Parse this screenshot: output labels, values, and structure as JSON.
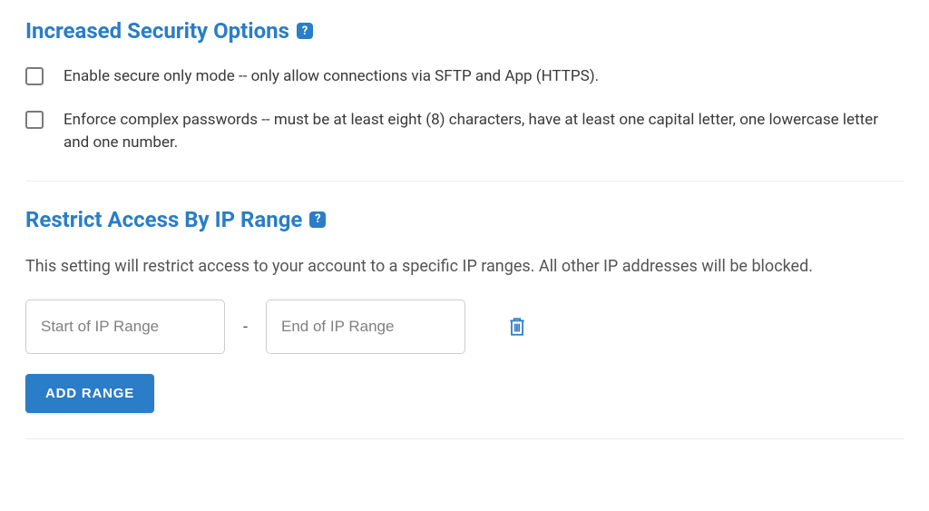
{
  "security_options": {
    "heading": "Increased Security Options",
    "help_symbol": "?",
    "items": [
      {
        "label": "Enable secure only mode -- only allow connections via SFTP and App (HTTPS)."
      },
      {
        "label": "Enforce complex passwords -- must be at least eight (8) characters, have at least one capital letter, one lowercase letter and one number."
      }
    ]
  },
  "ip_restrict": {
    "heading": "Restrict Access By IP Range",
    "help_symbol": "?",
    "description": "This setting will restrict access to your account to a specific IP ranges. All other IP addresses will be blocked.",
    "start_placeholder": "Start of IP Range",
    "end_placeholder": "End of IP Range",
    "range_separator": "-",
    "add_button_label": "ADD RANGE"
  },
  "colors": {
    "accent": "#2a7dc6"
  }
}
